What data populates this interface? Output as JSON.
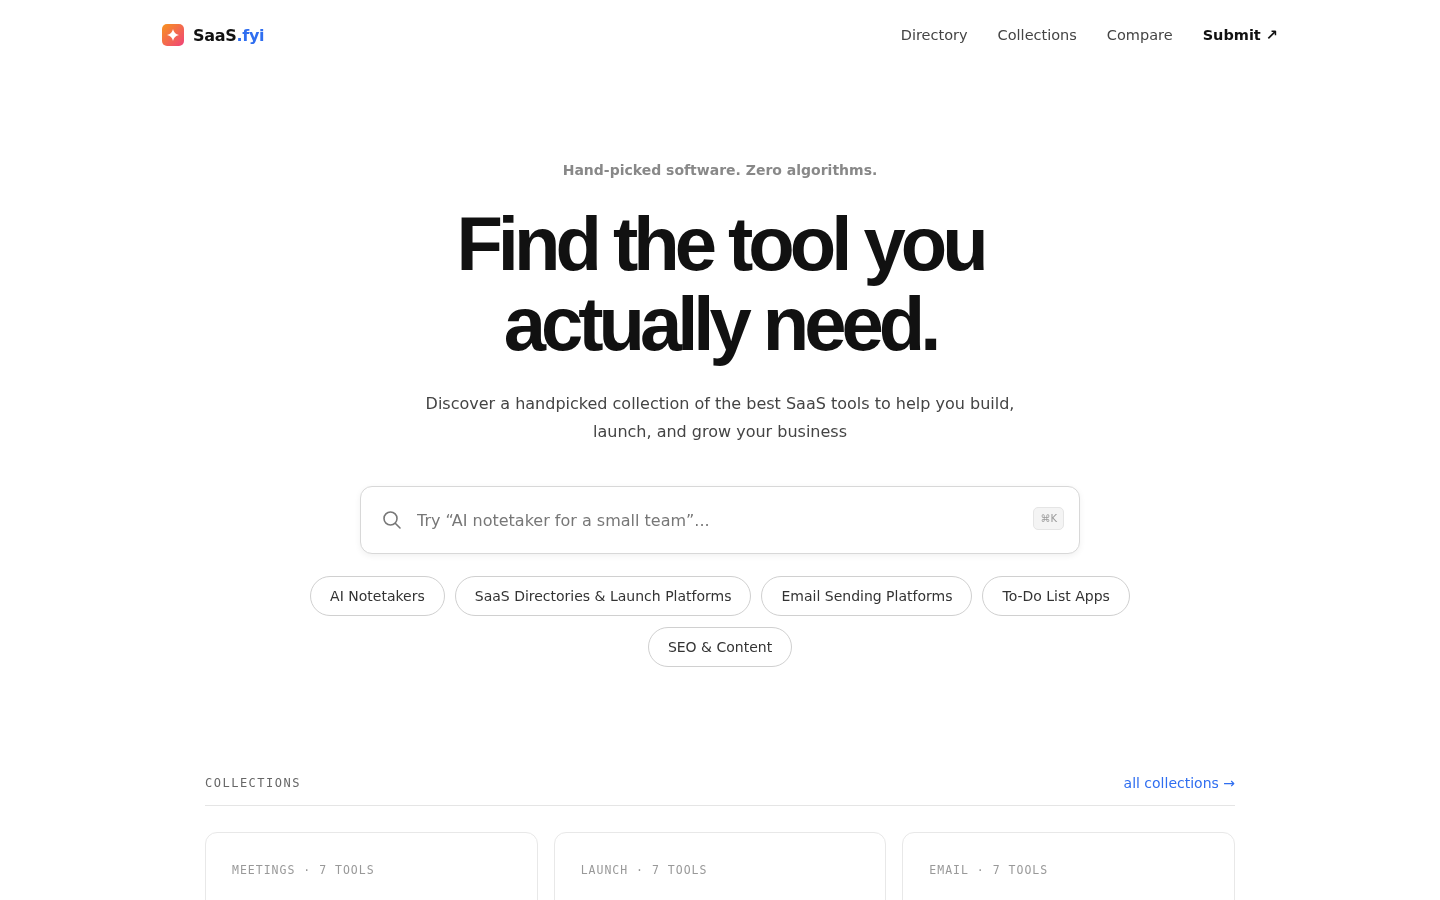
{
  "brand": {
    "name": "SaaS",
    "suffix": ".fyi"
  },
  "nav": [
    {
      "label": "Directory",
      "kind": "link"
    },
    {
      "label": "Collections",
      "kind": "link"
    },
    {
      "label": "Compare",
      "kind": "link"
    },
    {
      "label": "Submit ↗",
      "kind": "cta"
    }
  ],
  "hero": {
    "eyebrow": "Hand-picked software. Zero algorithms.",
    "title_lines": [
      "Find the tool you",
      "actually need."
    ],
    "subtitle": "Discover a handpicked collection of the best SaaS tools to help you build, launch, and grow your business"
  },
  "search": {
    "placeholder": "Try “AI notetaker for a small team”...",
    "shortcut": "⌘K"
  },
  "chips": [
    "AI Notetakers",
    "SaaS Directories & Launch Platforms",
    "Email Sending Platforms",
    "To-Do List Apps",
    "SEO & Content"
  ],
  "collections": {
    "heading": "COLLECTIONS",
    "link": "all collections →",
    "cards": [
      {
        "meta": "MEETINGS · 7 TOOLS"
      },
      {
        "meta": "LAUNCH · 7 TOOLS"
      },
      {
        "meta": "EMAIL · 7 TOOLS"
      }
    ]
  }
}
